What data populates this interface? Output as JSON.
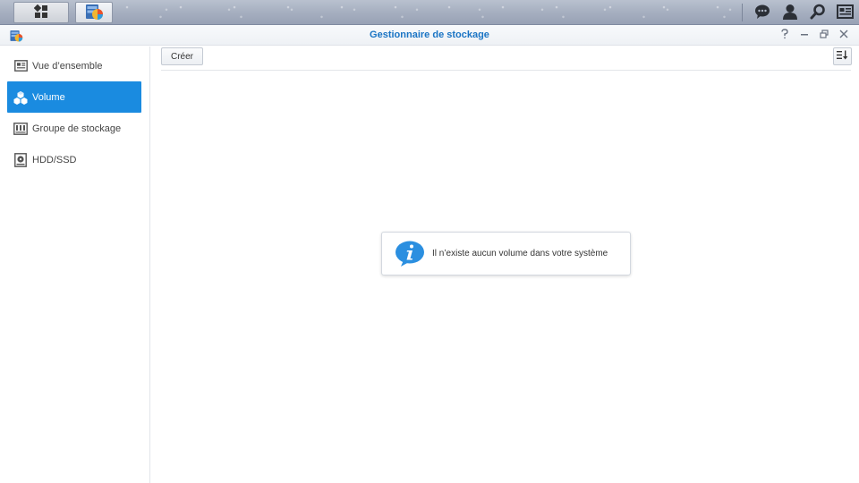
{
  "taskbar": {
    "main_menu_icon": "main-menu-icon",
    "active_app_icon": "storage-manager-icon",
    "right_icons": [
      "notifications-icon",
      "user-icon",
      "search-icon",
      "widgets-icon"
    ]
  },
  "window": {
    "title": "Gestionnaire de stockage",
    "controls": [
      "help-icon",
      "minimize-icon",
      "restore-icon",
      "close-icon"
    ]
  },
  "sidebar": {
    "items": [
      {
        "label": "Vue d’ensemble",
        "icon": "overview-icon",
        "active": false
      },
      {
        "label": "Volume",
        "icon": "volume-icon",
        "active": true
      },
      {
        "label": "Groupe de stockage",
        "icon": "storage-pool-icon",
        "active": false
      },
      {
        "label": "HDD/SSD",
        "icon": "hdd-icon",
        "active": false
      }
    ]
  },
  "toolbar": {
    "create_label": "Créer",
    "sort_icon": "sort-icon"
  },
  "empty_state": {
    "message": "Il n’existe aucun volume dans votre système",
    "icon": "info-icon"
  },
  "colors": {
    "accent": "#1a8be0",
    "title_text": "#1a74c4",
    "taskbar": "#a6afc0"
  }
}
